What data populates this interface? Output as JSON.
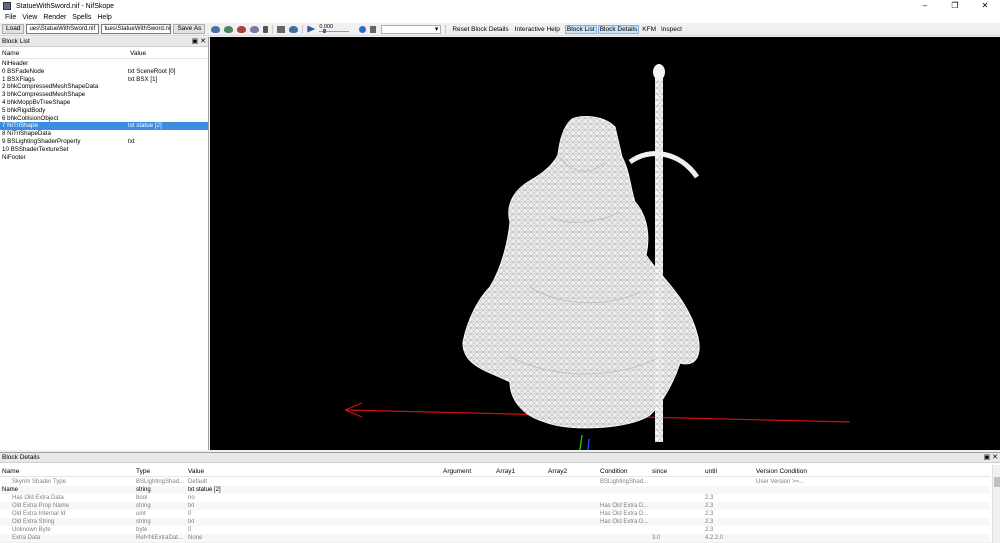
{
  "window": {
    "title": "StatueWithSword.nif - NifSkope",
    "controls": [
      "–",
      "❐",
      "✕"
    ]
  },
  "menu": [
    "File",
    "View",
    "Render",
    "Spells",
    "Help"
  ],
  "toolbar": {
    "load_label": "Load",
    "load_path": "ues\\StatueWithSword.nif",
    "save_path": "tues\\StatueWithSword.nif",
    "save_as_label": "Save As",
    "time_value": "0.000",
    "reset_label": "Reset Block Details",
    "interactive_help": "Interactive Help",
    "block_list": "Block List",
    "block_details": "Block Details",
    "kfm": "KFM",
    "inspect": "Inspect"
  },
  "block_list": {
    "dock_title": "Block List",
    "dock_controls": "▣ ✕",
    "columns": [
      "Name",
      "Value"
    ],
    "rows": [
      {
        "name": "NiHeader",
        "value": ""
      },
      {
        "name": "0 BSFadeNode",
        "value": "txt SceneRoot [0]"
      },
      {
        "name": "1 BSXFlags",
        "value": "txt BSX [1]"
      },
      {
        "name": "2 bhkCompressedMeshShapeData",
        "value": ""
      },
      {
        "name": "3 bhkCompressedMeshShape",
        "value": ""
      },
      {
        "name": "4 bhkMoppBvTreeShape",
        "value": ""
      },
      {
        "name": "5 bhkRigidBody",
        "value": ""
      },
      {
        "name": "6 bhkCollisionObject",
        "value": ""
      },
      {
        "name": "7 NiTriShape",
        "value": "txt statue [2]",
        "selected": true
      },
      {
        "name": "8 NiTriShapeData",
        "value": ""
      },
      {
        "name": "9 BSLightingShaderProperty",
        "value": "txt"
      },
      {
        "name": "10 BSShaderTextureSet",
        "value": ""
      },
      {
        "name": "NiFooter",
        "value": ""
      }
    ]
  },
  "block_details": {
    "dock_title": "Block Details",
    "dock_controls": "▣ ✕",
    "columns": [
      "Name",
      "Type",
      "Value",
      "Argument",
      "Array1",
      "Array2",
      "Condition",
      "since",
      "until",
      "Version Condition"
    ],
    "rows": [
      {
        "name": "Skyrim Shader Type",
        "type": "BSLightingShad...",
        "value": "Default",
        "cond": "BSLightingShad...",
        "since": "",
        "until": "",
        "vcond": "User Version >=..."
      },
      {
        "name": "Name",
        "type": "string",
        "value": "txt statue [2]",
        "cond": "",
        "since": "",
        "until": "",
        "vcond": "",
        "active": true
      },
      {
        "name": "Has Old Extra Data",
        "type": "bool",
        "value": "no",
        "cond": "",
        "since": "",
        "until": "2.3",
        "vcond": ""
      },
      {
        "name": "Old Extra Prop Name",
        "type": "string",
        "value": "txt",
        "cond": "Has Old Extra D...",
        "since": "",
        "until": "2.3",
        "vcond": ""
      },
      {
        "name": "Old Extra Internal Id",
        "type": "uint",
        "value": "0",
        "cond": "Has Old Extra D...",
        "since": "",
        "until": "2.3",
        "vcond": ""
      },
      {
        "name": "Old Extra String",
        "type": "string",
        "value": "txt",
        "cond": "Has Old Extra D...",
        "since": "",
        "until": "2.3",
        "vcond": ""
      },
      {
        "name": "Unknown Byte",
        "type": "byte",
        "value": "0",
        "cond": "",
        "since": "",
        "until": "2.3",
        "vcond": ""
      },
      {
        "name": "Extra Data",
        "type": "Ref<NiExtraDat...",
        "value": "None",
        "cond": "",
        "since": "3.0",
        "until": "4.2.2.0",
        "vcond": ""
      }
    ]
  },
  "colors": {
    "selection": "#3a8de0",
    "viewport_bg": "#000000",
    "axis_x": "#d01010",
    "axis_y": "#10c010",
    "axis_z": "#2040ff"
  }
}
